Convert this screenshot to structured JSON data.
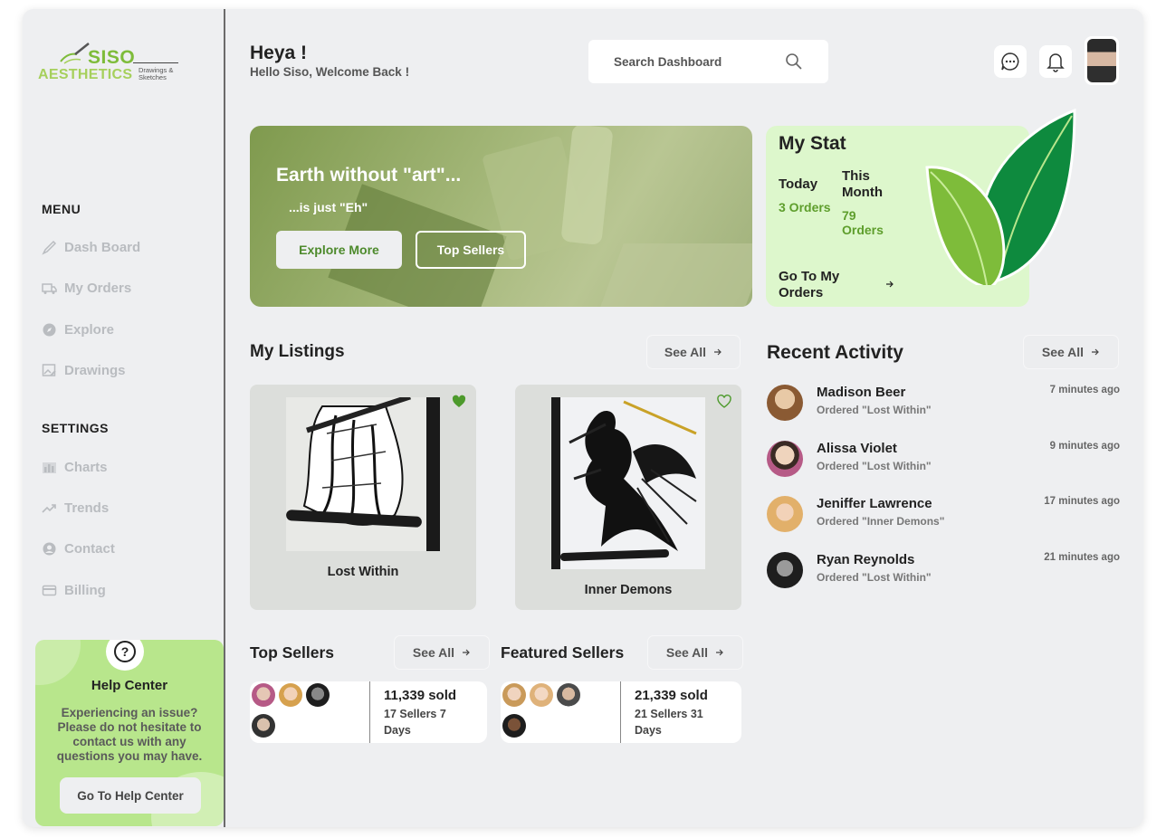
{
  "brand": {
    "name_top": "SISO",
    "name_bottom": "AESTHETICS",
    "tagline": "Drawings & Sketches"
  },
  "sidebar": {
    "menu_title": "MENU",
    "menu_items": [
      {
        "label": "Dash Board",
        "icon": "brush-icon"
      },
      {
        "label": "My Orders",
        "icon": "truck-icon"
      },
      {
        "label": "Explore",
        "icon": "compass-icon"
      },
      {
        "label": "Drawings",
        "icon": "image-edit-icon"
      }
    ],
    "settings_title": "SETTINGS",
    "settings_items": [
      {
        "label": "Charts",
        "icon": "bar-chart-icon"
      },
      {
        "label": "Trends",
        "icon": "trend-icon"
      },
      {
        "label": "Contact",
        "icon": "user-circle-icon"
      },
      {
        "label": "Billing",
        "icon": "card-icon"
      }
    ],
    "help": {
      "title": "Help Center",
      "text": "Experiencing an issue? Please do not hesitate to contact us with any questions you may have.",
      "button": "Go To Help Center"
    }
  },
  "header": {
    "greeting": "Heya !",
    "subtitle": "Hello Siso, Welcome Back !",
    "search_placeholder": "Search Dashboard"
  },
  "hero": {
    "title": "Earth without \"art\"...",
    "subtitle": "...is just \"Eh\"",
    "explore_button": "Explore More",
    "sellers_button": "Top Sellers"
  },
  "stat": {
    "title": "My Stat",
    "today_label": "Today",
    "today_value": "3 Orders",
    "month_label": "This Month",
    "month_value": "79 Orders",
    "link": "Go To My Orders"
  },
  "listings": {
    "title": "My Listings",
    "see_all": "See All",
    "items": [
      {
        "name": "Lost Within",
        "favorited": true
      },
      {
        "name": "Inner Demons",
        "favorited": false
      }
    ]
  },
  "activity": {
    "title": "Recent Activity",
    "see_all": "See All",
    "items": [
      {
        "name": "Madison Beer",
        "action": "Ordered \"Lost Within\"",
        "time": "7 minutes ago"
      },
      {
        "name": "Alissa Violet",
        "action": "Ordered \"Lost Within\"",
        "time": "9 minutes ago"
      },
      {
        "name": "Jeniffer Lawrence",
        "action": "Ordered \"Inner Demons\"",
        "time": "17 minutes ago"
      },
      {
        "name": "Ryan Reynolds",
        "action": "Ordered \"Lost Within\"",
        "time": "21 minutes ago"
      }
    ]
  },
  "top_sellers": {
    "title": "Top Sellers",
    "see_all": "See All",
    "sold": "11,339 sold",
    "meta": "17 Sellers   7 Days"
  },
  "featured_sellers": {
    "title": "Featured Sellers",
    "see_all": "See All",
    "sold": "21,339 sold",
    "meta": "21 Sellers   31 Days"
  },
  "colors": {
    "accent": "#5e9e2c",
    "help_bg": "#b8e68c",
    "stat_bg": "#ddf7cc",
    "app_bg": "#eeeff1"
  }
}
